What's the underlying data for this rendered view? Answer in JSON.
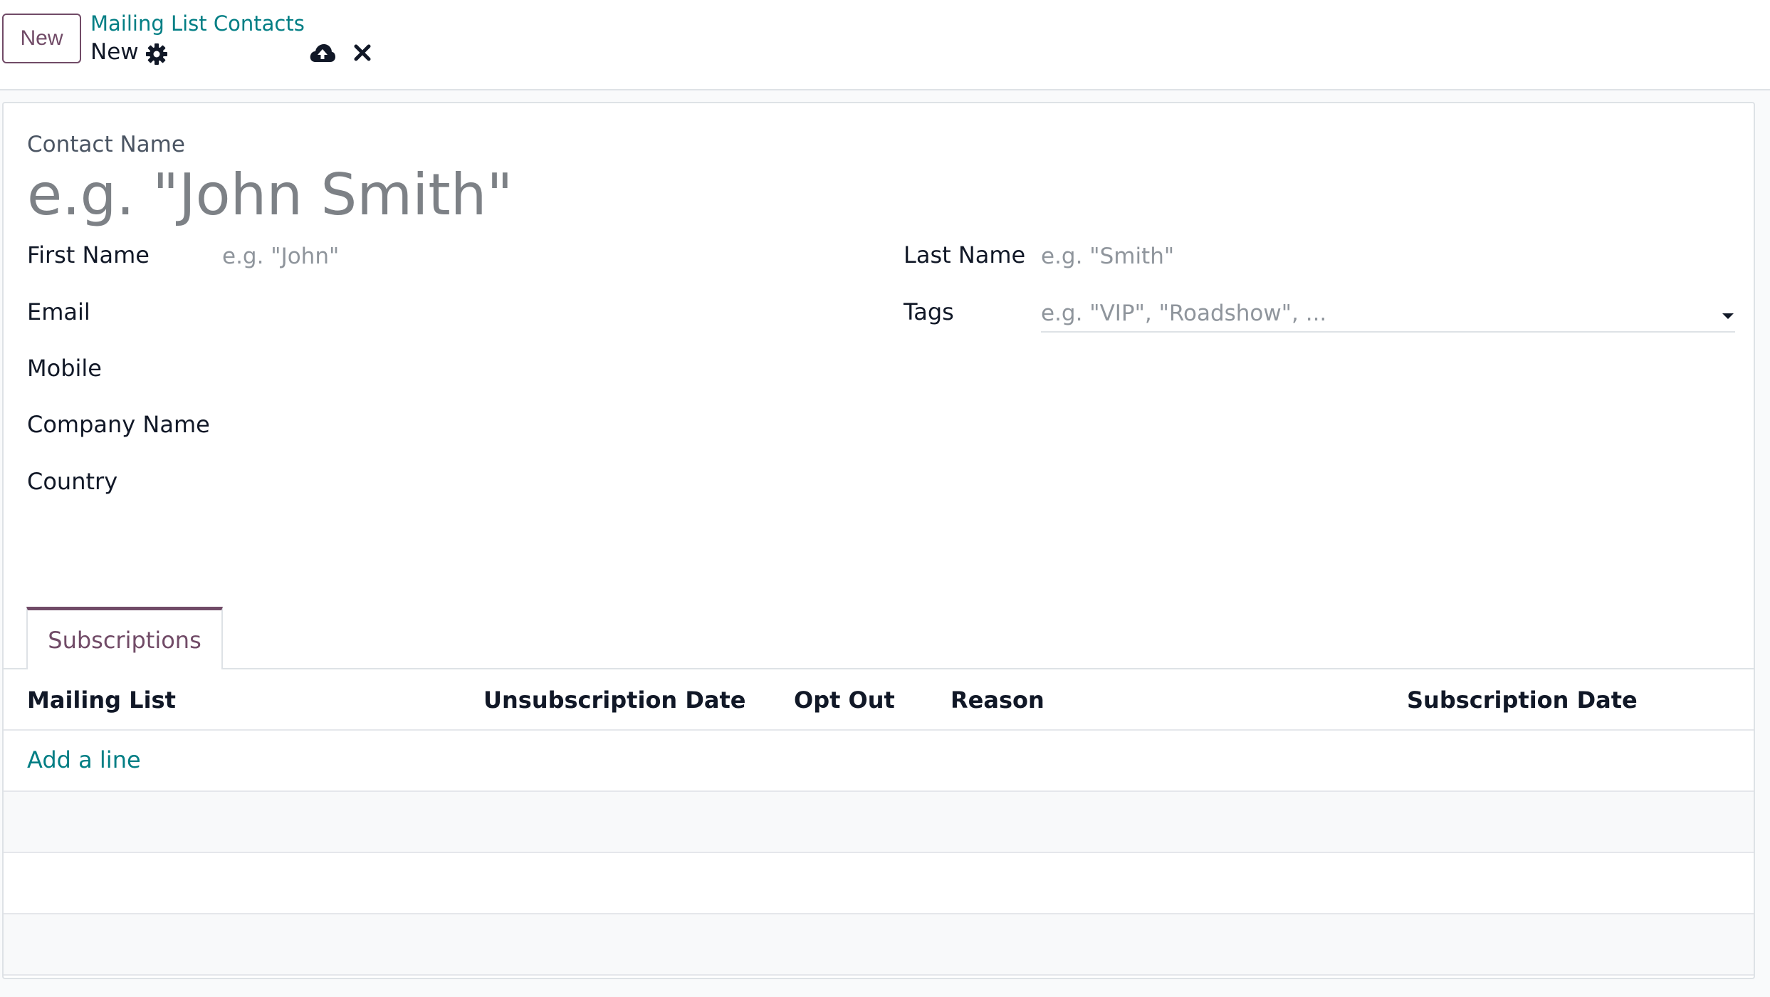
{
  "control_panel": {
    "new_button": "New",
    "breadcrumb": "Mailing List Contacts",
    "record_title": "New",
    "icons": [
      "gear-icon",
      "cloud-upload-icon",
      "close-icon"
    ]
  },
  "form": {
    "contact_name_label": "Contact Name",
    "contact_name_placeholder": "e.g. \"John Smith\"",
    "first_name_label": "First Name",
    "first_name_placeholder": "e.g. \"John\"",
    "last_name_label": "Last Name",
    "last_name_placeholder": "e.g. \"Smith\"",
    "email_label": "Email",
    "tags_label": "Tags",
    "tags_placeholder": "e.g. \"VIP\", \"Roadshow\", ...",
    "mobile_label": "Mobile",
    "company_label": "Company Name",
    "country_label": "Country"
  },
  "tabs": [
    {
      "label": "Subscriptions",
      "active": true
    }
  ],
  "subscriptions_table": {
    "columns": [
      "Mailing List",
      "Unsubscription Date",
      "Opt Out",
      "Reason",
      "Subscription Date"
    ],
    "add_line": "Add a line",
    "rows": []
  },
  "colors": {
    "brand": "#714b67",
    "link": "#017e84"
  }
}
